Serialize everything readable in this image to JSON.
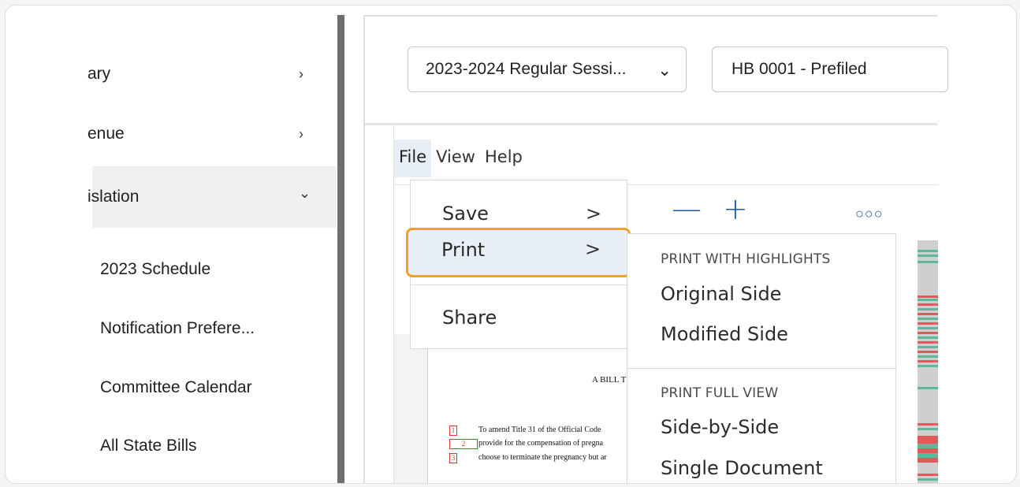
{
  "sidebar": {
    "items": [
      {
        "label": "ary",
        "chevron": "chevron-right-icon",
        "glyph": "›"
      },
      {
        "label": "enue",
        "chevron": "chevron-right-icon",
        "glyph": "›"
      },
      {
        "label": "islation",
        "chevron": "chevron-down-icon",
        "glyph": "⌄"
      }
    ],
    "sub_items": [
      "2023 Schedule",
      "Notification Prefere...",
      "Committee Calendar",
      "All State Bills"
    ]
  },
  "header": {
    "session_select": {
      "value": "2023-2024 Regular Sessi...",
      "caret": "⌄"
    },
    "bill_select": {
      "value": "HB 0001 - Prefiled"
    }
  },
  "menubar": {
    "items": [
      "File",
      "View",
      "Help"
    ],
    "active": "File"
  },
  "toolbar": {
    "zoom_out": "—",
    "zoom_in": "+",
    "more": "○○○"
  },
  "file_menu": {
    "items": [
      {
        "label": "Save",
        "arrow": ">"
      },
      {
        "label": "Print",
        "arrow": ">"
      },
      {
        "label": "Share"
      }
    ],
    "highlighted": "Print",
    "highlight_color": "#f0a12c"
  },
  "print_submenu": {
    "section1_heading": "PRINT WITH HIGHLIGHTS",
    "section1_options": [
      "Original Side",
      "Modified Side"
    ],
    "section2_heading": "PRINT FULL VIEW",
    "section2_options": [
      "Side-by-Side",
      "Single Document"
    ]
  },
  "document": {
    "title": "A BILL T",
    "lines": [
      {
        "num": "1",
        "text": "To amend Title 31 of the Official Code"
      },
      {
        "num": "2",
        "text": "provide for the compensation of pregna"
      },
      {
        "num": "3",
        "text": "choose to terminate the pregnancy but ar"
      }
    ]
  },
  "colors": {
    "accent_blue": "#1f5aa6",
    "removed_red": "#e05a5a",
    "added_green": "#5fb89a"
  }
}
